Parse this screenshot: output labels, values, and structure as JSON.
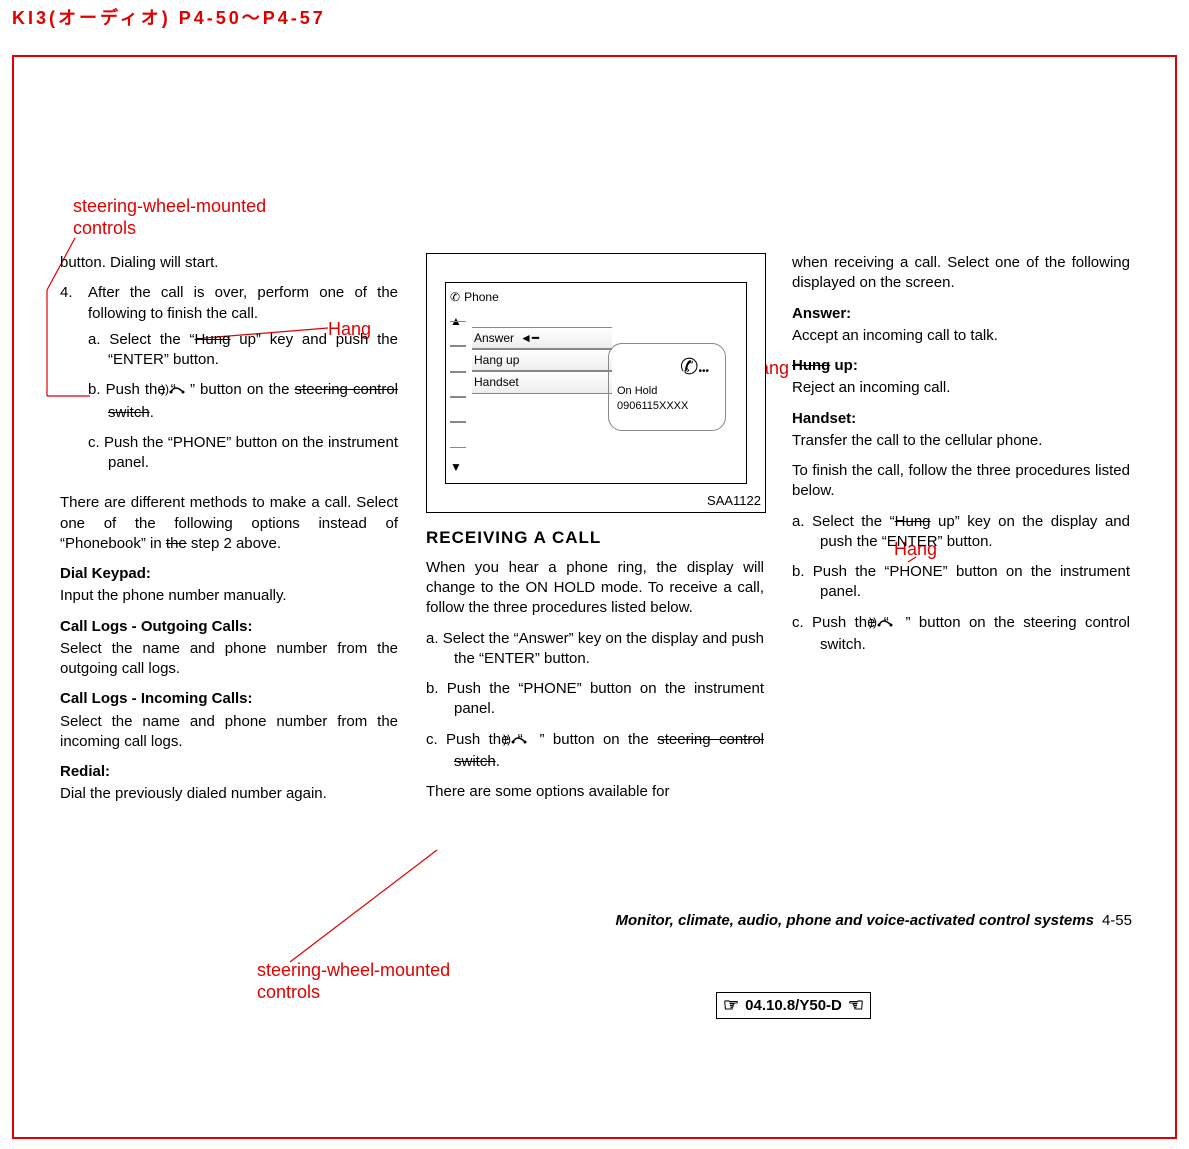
{
  "doc_header": "KI3(オーディオ) P4-50～P4-57",
  "annotations": {
    "top_left": "steering-wheel-mounted\ncontrols",
    "hang1": "Hang",
    "bottom": "steering-wheel-mounted\ncontrols",
    "hang2": "Hang",
    "hang3": "Hang"
  },
  "col1": {
    "p1": "button. Dialing will start.",
    "step4_num": "4.",
    "step4": "After the call is over, perform one of the following to finish the call.",
    "a_pre": "a. Select the “",
    "a_strike": "Hung",
    "a_post": " up” key and push the “ENTER” button.",
    "b_pre": "b. Push  the  “ ",
    "b_post": " ”  button  on  the ",
    "b_strike": "steering control switch",
    "b_end": ".",
    "c": "c. Push the “PHONE” button on the in­strument panel.",
    "p2_pre": "There are different methods to make a call. Select one of the following options instead of “Phonebook” in ",
    "p2_strike": "the",
    "p2_post": " step 2 above.",
    "dial_h": "Dial Keypad:",
    "dial_b": "Input the phone number manually.",
    "out_h": "Call Logs - Outgoing Calls:",
    "out_b": "Select the name and phone number from the outgoing call logs.",
    "in_h": "Call Logs - Incoming Calls:",
    "in_b": "Select the name and phone number from the incoming call logs.",
    "re_h": "Redial:",
    "re_b": "Dial the previously dialed number again."
  },
  "figure": {
    "label": "SAA1122",
    "title": "Phone",
    "rows": [
      "Answer",
      "Hang up",
      "Handset"
    ],
    "hold1": "On Hold",
    "hold2": "0906115XXXX"
  },
  "col2": {
    "h": "RECEIVING A CALL",
    "p1": "When you hear a phone ring, the display will change to the ON HOLD mode. To re­ceive a call, follow the three procedures listed below.",
    "a": "a.  Select the “Answer” key on the dis­play and push the “ENTER” button.",
    "b": "b.  Push the “PHONE” button on the in­strument panel.",
    "c_pre": "c.  Push  the  “ ",
    "c_post": " ”  button  on  the ",
    "c_strike": "steering control switch",
    "c_end": ".",
    "p2": "There  are  some  options  available  for"
  },
  "col3": {
    "p1": "when receiving a call. Select one of the following displayed on the screen.",
    "ans_h": "Answer:",
    "ans_b": "Accept an incoming call to talk.",
    "hung_strike": "Hung",
    "hung_post": " up:",
    "hung_b": "Reject an incoming call.",
    "hand_h": "Handset:",
    "hand_b": "Transfer the call to the cellular phone.",
    "p2": "To finish the call, follow the three proce­dures listed below.",
    "a_pre": "a.  Select the “",
    "a_strike": "Hung",
    "a_post": " up” key on the dis­play and push the “ENTER” button.",
    "b": "b.  Push the “PHONE” button on the in­strument panel.",
    "c_pre": "c.  Push  the  “ ",
    "c_post": " ”  button  on  the steering control switch."
  },
  "footer": {
    "title": "Monitor, climate, audio, phone and voice-activated control systems",
    "page": "4-55"
  },
  "revbox": "04.10.8/Y50-D"
}
